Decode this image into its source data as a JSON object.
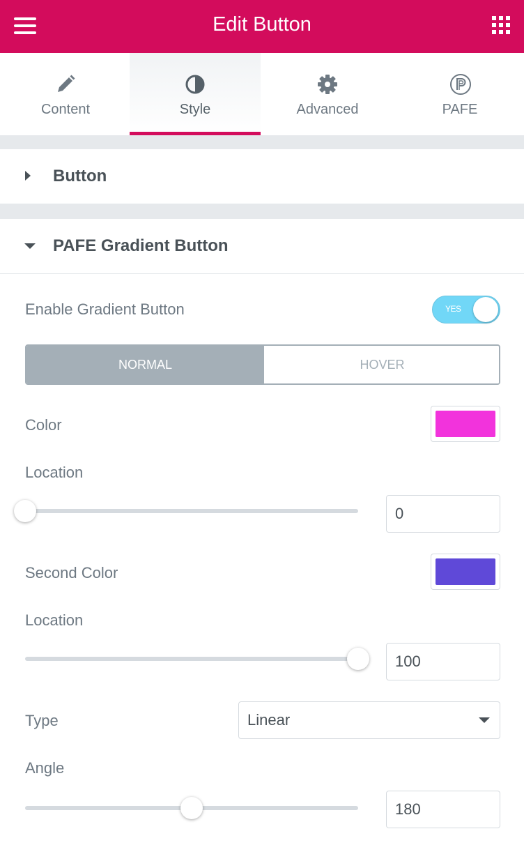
{
  "header": {
    "title": "Edit Button",
    "menu_icon": "hamburger-menu-icon",
    "apps_icon": "grid-apps-icon",
    "background": "#d30c5c"
  },
  "tabs": [
    {
      "label": "Content",
      "icon": "pencil-icon",
      "active": false
    },
    {
      "label": "Style",
      "icon": "half-circle-contrast-icon",
      "active": true
    },
    {
      "label": "Advanced",
      "icon": "gear-icon",
      "active": false
    },
    {
      "label": "PAFE",
      "icon": "pafe-logo-icon",
      "active": false
    }
  ],
  "sections": {
    "button": {
      "title": "Button",
      "expanded": false
    },
    "gradient": {
      "title": "PAFE Gradient Button",
      "expanded": true
    }
  },
  "controls": {
    "enable_gradient": {
      "label": "Enable Gradient Button",
      "toggle_text": "YES",
      "on": true
    },
    "state_tabs": {
      "normal": "NORMAL",
      "hover": "HOVER",
      "selected": "NORMAL"
    },
    "color": {
      "label": "Color",
      "value": "#f233dc"
    },
    "location_1": {
      "label": "Location",
      "value": "0",
      "min": 0,
      "max": 100
    },
    "second_color": {
      "label": "Second Color",
      "value": "#5f49d8"
    },
    "location_2": {
      "label": "Location",
      "value": "100",
      "min": 0,
      "max": 100
    },
    "type": {
      "label": "Type",
      "value": "Linear"
    },
    "angle": {
      "label": "Angle",
      "value": "180",
      "min": 0,
      "max": 360
    }
  }
}
